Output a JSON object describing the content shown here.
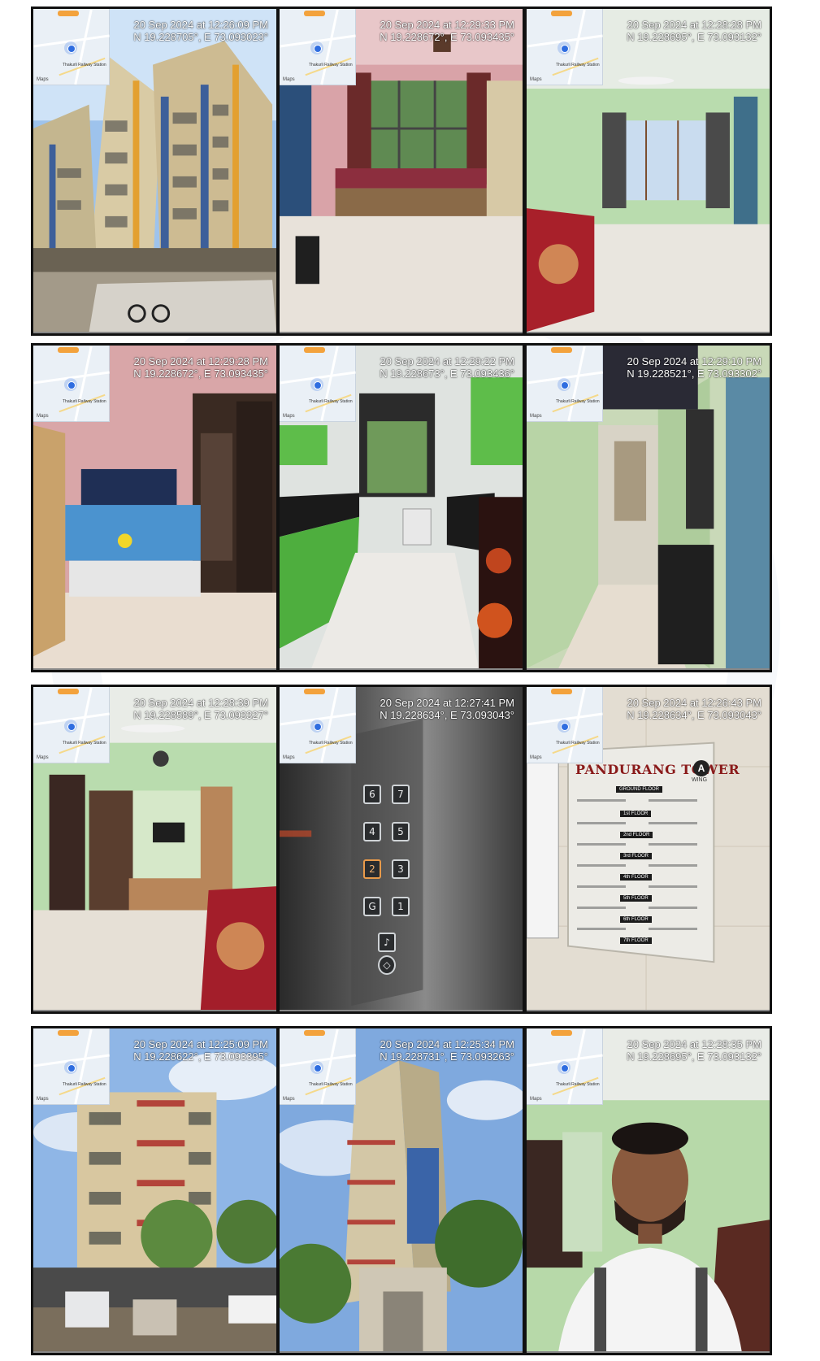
{
  "photos": [
    {
      "id": "p1",
      "stamp_date": "20 Sep 2024 at 12:26:09 PM",
      "stamp_coords": "N 19.228705°, E 73.093023°"
    },
    {
      "id": "p2",
      "stamp_date": "20 Sep 2024 at 12:29:33 PM",
      "stamp_coords": "N 19.228672°, E 73.093435°"
    },
    {
      "id": "p3",
      "stamp_date": "20 Sep 2024 at 12:28:28 PM",
      "stamp_coords": "N 19.228695°, E 73.093132°"
    },
    {
      "id": "p4",
      "stamp_date": "20 Sep 2024 at 12:29:28 PM",
      "stamp_coords": "N 19.228672°, E 73.093435°"
    },
    {
      "id": "p5",
      "stamp_date": "20 Sep 2024 at 12:29:22 PM",
      "stamp_coords": "N 19.228673°, E 73.093436°"
    },
    {
      "id": "p6",
      "stamp_date": "20 Sep 2024 at 12:29:10 PM",
      "stamp_coords": "N 19.228521°, E 73.093302°"
    },
    {
      "id": "p7",
      "stamp_date": "20 Sep 2024 at 12:28:39 PM",
      "stamp_coords": "N 19.228589°, E 73.093327°"
    },
    {
      "id": "p8",
      "stamp_date": "20 Sep 2024 at 12:27:41 PM",
      "stamp_coords": "N 19.228634°, E 73.093043°"
    },
    {
      "id": "p9",
      "stamp_date": "20 Sep 2024 at 12:26:43 PM",
      "stamp_coords": "N 19.228634°, E 73.093043°"
    },
    {
      "id": "p10",
      "stamp_date": "20 Sep 2024 at 12:25:09 PM",
      "stamp_coords": "N 19.228622°, E 73.093395°"
    },
    {
      "id": "p11",
      "stamp_date": "20 Sep 2024 at 12:25:34 PM",
      "stamp_coords": "N 19.228731°, E 73.093263°"
    },
    {
      "id": "p12",
      "stamp_date": "20 Sep 2024 at 12:28:35 PM",
      "stamp_coords": "N 19.228695°, E 73.093132°"
    }
  ],
  "map_thumb": {
    "maps_mark": "Maps",
    "station_label": "Thakurli Railway Station"
  },
  "lift_panel": {
    "buttons": [
      "6",
      "7",
      "4",
      "5",
      "2",
      "3",
      "G",
      "1"
    ],
    "lit_button": "2"
  },
  "building_board": {
    "title": "PANDURANG TOWER",
    "wing": "A",
    "wing_word": "WING",
    "floors": [
      "GROUND FLOOR",
      "1st FLOOR",
      "2nd FLOOR",
      "3rd FLOOR",
      "4th FLOOR",
      "5th FLOOR",
      "6th FLOOR",
      "7th FLOOR"
    ]
  },
  "colors": {
    "stamp_text": "#ffffff",
    "border": "#111111",
    "sky": "#8fb6e6",
    "pink_wall": "#d9a3a8",
    "green_wall": "#b9dcae"
  }
}
